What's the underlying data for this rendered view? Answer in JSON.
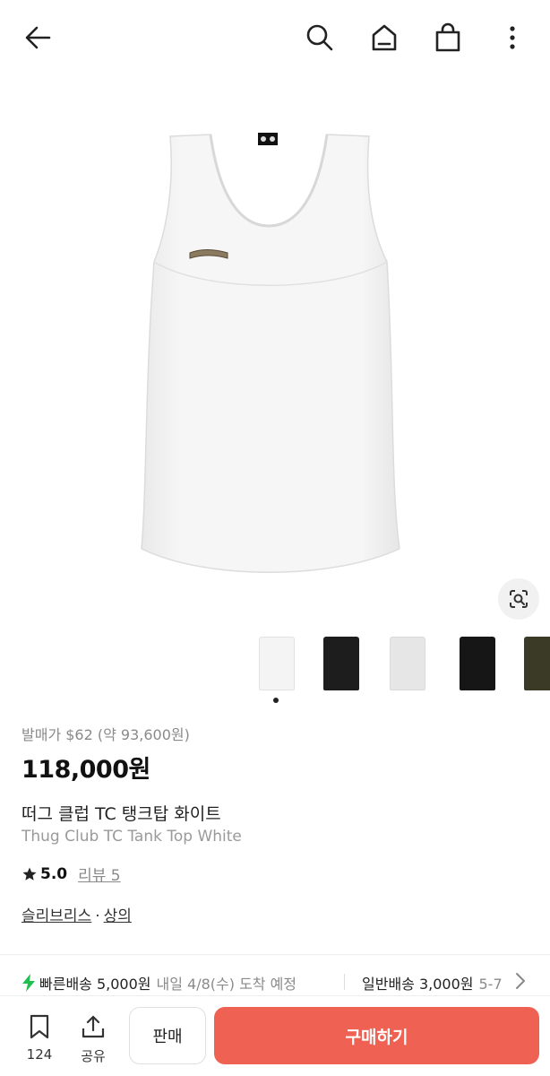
{
  "header": {
    "icons": [
      "back-arrow-icon",
      "search-icon",
      "home-icon",
      "shopping-bag-icon",
      "more-vertical-icon"
    ]
  },
  "gallery": {
    "thumbnail_colors": [
      "#f4f4f4",
      "#1d1d1d",
      "#e6e6e6",
      "#161616",
      "#3b3a26"
    ],
    "active_index": 0
  },
  "product": {
    "release_price": "발매가 $62 (약 93,600원)",
    "price": "118,000원",
    "name_ko": "떠그 클럽 TC 탱크탑 화이트",
    "name_en": "Thug Club TC Tank Top White",
    "rating": "5.0",
    "review_link": "리뷰 5",
    "category_1": "슬리브리스",
    "category_sep": "·",
    "category_2": "상의"
  },
  "shipping": {
    "fast_label": "빠른배송 5,000원",
    "fast_eta": "내일 4/8(수) 도착 예정",
    "normal_label": "일반배송 3,000원",
    "normal_eta": "5-7"
  },
  "bottom_bar": {
    "save_count": "124",
    "share_label": "공유",
    "sell_label": "판매",
    "buy_label": "구매하기"
  },
  "colors": {
    "accent": "#ef6253",
    "fast_ship": "#1fbf4f"
  }
}
